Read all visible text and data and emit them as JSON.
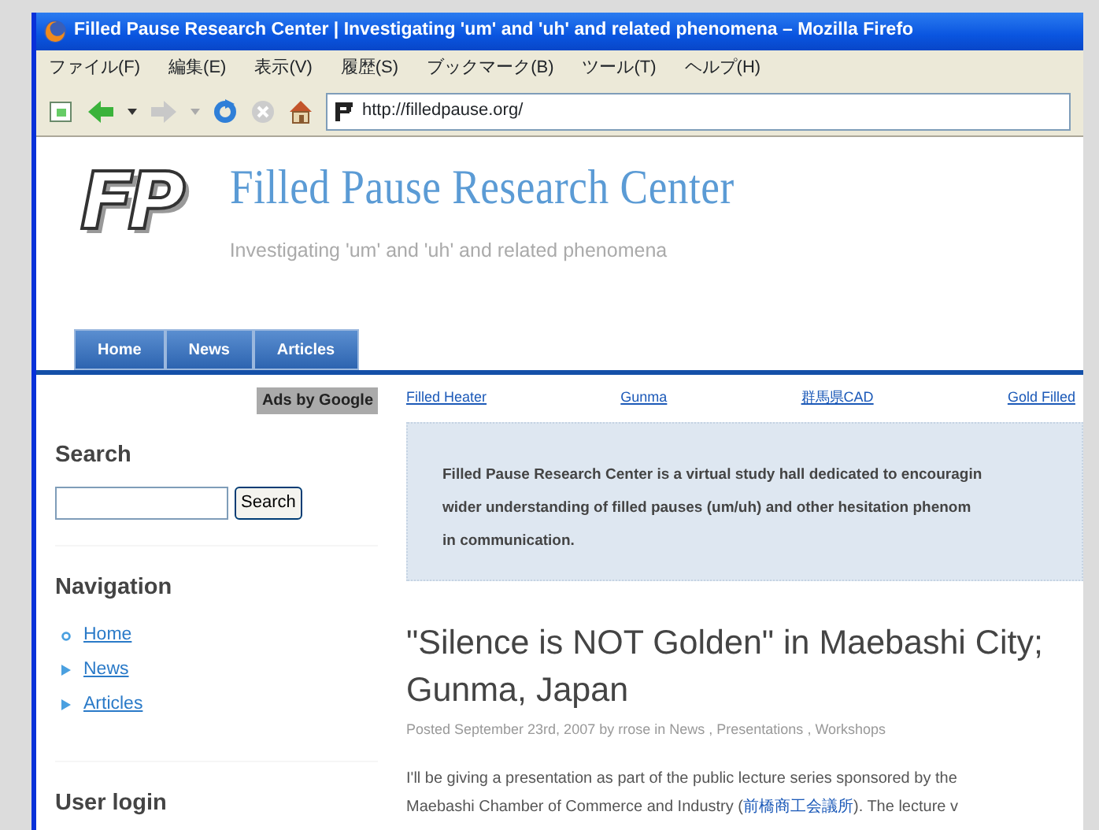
{
  "window": {
    "title": "Filled Pause Research Center | Investigating 'um' and 'uh' and related phenomena – Mozilla Firefo"
  },
  "menu": [
    "ファイル(F)",
    "編集(E)",
    "表示(V)",
    "履歴(S)",
    "ブックマーク(B)",
    "ツール(T)",
    "ヘルプ(H)"
  ],
  "toolbar": {
    "address": "http://filledpause.org/"
  },
  "site": {
    "logo_text": "FP",
    "title": "Filled Pause Research Center",
    "tagline": "Investigating 'um' and 'uh' and related phenomena",
    "tabs": [
      {
        "label": "Home"
      },
      {
        "label": "News"
      },
      {
        "label": "Articles"
      }
    ]
  },
  "sidebar": {
    "ads_label": "Ads by Google",
    "search": {
      "heading": "Search",
      "button": "Search"
    },
    "navigation": {
      "heading": "Navigation",
      "items": [
        {
          "label": "Home",
          "kind": "leaf"
        },
        {
          "label": "News",
          "kind": "collapsed"
        },
        {
          "label": "Articles",
          "kind": "collapsed"
        }
      ]
    },
    "login": {
      "heading": "User login"
    }
  },
  "ad_links": [
    "Filled Heater",
    "Gunma",
    "群馬県CAD",
    "Gold Filled"
  ],
  "intro": {
    "lines": [
      "Filled Pause Research Center is a virtual study hall dedicated to encouragin",
      "wider understanding of filled pauses (um/uh) and other hesitation phenom",
      "in communication."
    ]
  },
  "post": {
    "title_lines": [
      "\"Silence is NOT Golden\" in Maebashi City;",
      "Gunma, Japan"
    ],
    "meta": "Posted September 23rd, 2007 by rrose in",
    "tags": [
      "News",
      "Presentations",
      "Workshops"
    ],
    "tag_separator": " , ",
    "body_lines": [
      {
        "parts": [
          {
            "text": "I'll be giving a presentation as part of the public lecture series sponsored by the",
            "link": false
          }
        ]
      },
      {
        "parts": [
          {
            "text": "Maebashi Chamber of Commerce and Industry (",
            "link": false
          },
          {
            "text": "前橋商工会議所",
            "link": true
          },
          {
            "text": "). The lecture v",
            "link": false
          }
        ]
      }
    ]
  }
}
